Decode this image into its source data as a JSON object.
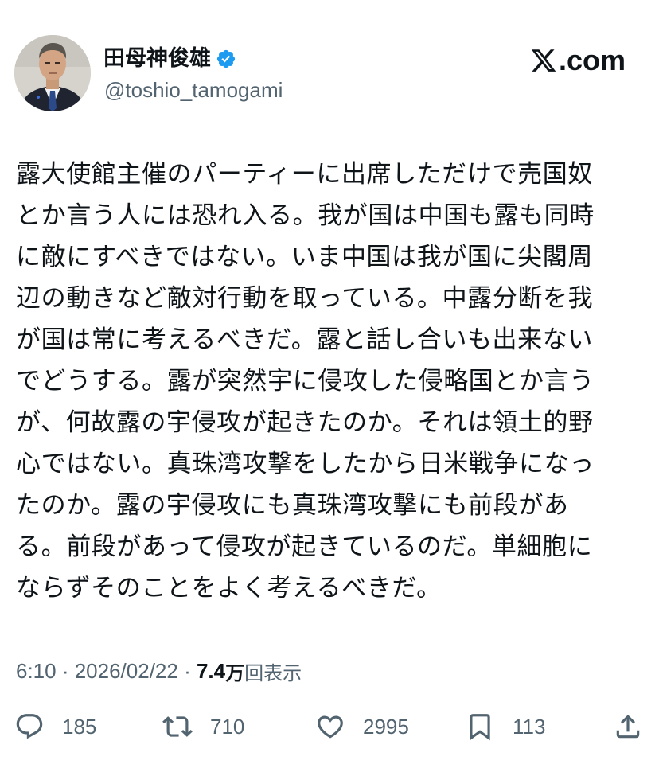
{
  "author": {
    "display_name": "田母神俊雄",
    "handle": "@toshio_tamogami",
    "verified": true,
    "verified_color": "#1d9bf0"
  },
  "brand": {
    "label": ".com",
    "icon": "x-logo-icon"
  },
  "tweet": {
    "text": "露大使館主催のパーティーに出席しただけで売国奴\nとか言う人には恐れ入る。我が国は中国も露も同時\nに敵にすべきではない。いま中国は我が国に尖閣周\n辺の動きなど敵対行動を取っている。中露分断を我\nが国は常に考えるべきだ。露と話し合いも出来ない\nでどうする。露が突然宇に侵攻した侵略国とか言う\nが、何故露の宇侵攻が起きたのか。それは領土的野\n心ではない。真珠湾攻撃をしたから日米戦争になっ\nたのか。露の宇侵攻にも真珠湾攻撃にも前段があ\nる。前段があって侵攻が起きているのだ。単細胞に\nならずそのことをよく考えるべきだ。"
  },
  "meta": {
    "time": "6:10",
    "separator": " · ",
    "date": "2026/02/22",
    "separator2": " · ",
    "views_count": "7.4",
    "views_unit": "万",
    "views_label": "回表示"
  },
  "actions": {
    "replies": "185",
    "reposts": "710",
    "likes": "2995",
    "bookmarks": "113"
  },
  "colors": {
    "text": "#0f1419",
    "secondary": "#536471",
    "background": "#ffffff"
  }
}
